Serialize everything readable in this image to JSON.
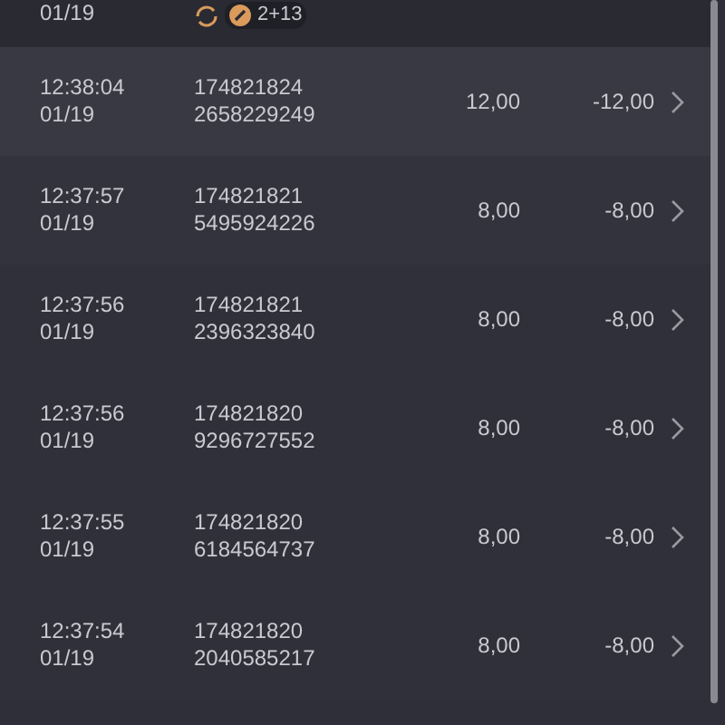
{
  "partial_row": {
    "date": "01/19",
    "badge": "2+13"
  },
  "rows": [
    {
      "time": "12:38:04",
      "date": "01/19",
      "id_line_1": "174821824",
      "id_line_2": "2658229249",
      "amount": "12,00",
      "result": "-12,00"
    },
    {
      "time": "12:37:57",
      "date": "01/19",
      "id_line_1": "174821821",
      "id_line_2": "5495924226",
      "amount": "8,00",
      "result": "-8,00"
    },
    {
      "time": "12:37:56",
      "date": "01/19",
      "id_line_1": "174821821",
      "id_line_2": "2396323840",
      "amount": "8,00",
      "result": "-8,00"
    },
    {
      "time": "12:37:56",
      "date": "01/19",
      "id_line_1": "174821820",
      "id_line_2": "9296727552",
      "amount": "8,00",
      "result": "-8,00"
    },
    {
      "time": "12:37:55",
      "date": "01/19",
      "id_line_1": "174821820",
      "id_line_2": "6184564737",
      "amount": "8,00",
      "result": "-8,00"
    },
    {
      "time": "12:37:54",
      "date": "01/19",
      "id_line_1": "174821820",
      "id_line_2": "2040585217",
      "amount": "8,00",
      "result": "-8,00"
    }
  ]
}
